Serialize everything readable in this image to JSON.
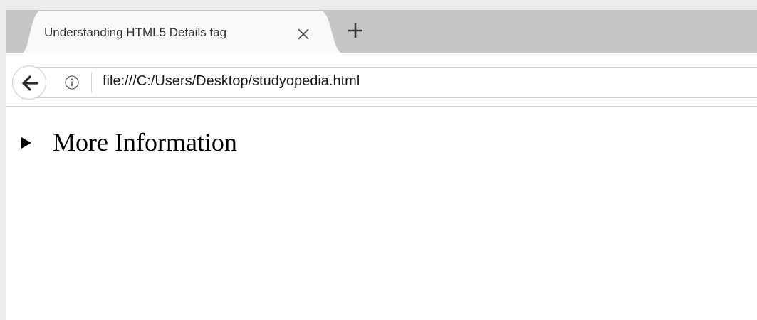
{
  "browser": {
    "tab": {
      "title": "Understanding HTML5 Details tag",
      "close_icon": "close-icon"
    },
    "new_tab_icon": "plus-icon",
    "toolbar": {
      "back_icon": "back-arrow-icon",
      "info_icon": "info-icon",
      "url": "file:///C:/Users/Desktop/studyopedia.html"
    }
  },
  "page": {
    "details": {
      "summary": "More Information",
      "open": false,
      "marker_icon": "disclosure-triangle-icon"
    }
  },
  "colors": {
    "tabstrip": "#c6c6c6",
    "active_tab": "#f9f9f9",
    "window_frame": "#ececec",
    "text": "#000000"
  }
}
